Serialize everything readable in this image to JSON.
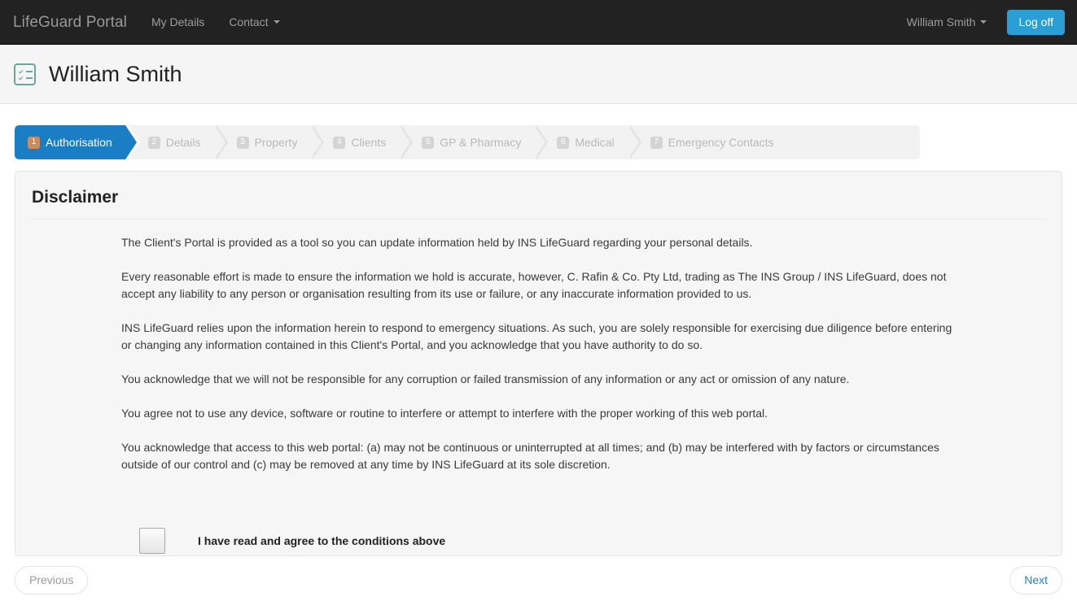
{
  "navbar": {
    "brand": "LifeGuard Portal",
    "links": [
      {
        "label": "My Details",
        "caret": false
      },
      {
        "label": "Contact",
        "caret": true
      }
    ],
    "user_menu": "William Smith",
    "logoff_label": "Log off",
    "background_color": "#222222",
    "accent_color": "#2a9fd6"
  },
  "page_header": {
    "icon": "checklist-icon",
    "title": "William Smith",
    "icon_color": "#6aa99a"
  },
  "wizard": {
    "active_index": 0,
    "active_color": "#1a7ec4",
    "steps": [
      {
        "number": "1",
        "label": "Authorisation"
      },
      {
        "number": "2",
        "label": "Details"
      },
      {
        "number": "3",
        "label": "Property"
      },
      {
        "number": "4",
        "label": "Clients"
      },
      {
        "number": "5",
        "label": "GP & Pharmacy"
      },
      {
        "number": "6",
        "label": "Medical"
      },
      {
        "number": "7",
        "label": "Emergency Contacts"
      }
    ]
  },
  "panel": {
    "title": "Disclaimer",
    "paragraphs": [
      "The Client's Portal is provided as a tool so you can update information held by INS LifeGuard regarding your personal details.",
      "Every reasonable effort is made to ensure the information we hold is accurate, however, C. Rafin & Co. Pty Ltd, trading as The INS Group / INS LifeGuard, does not accept any liability to any person or organisation resulting from its use or failure, or any inaccurate information provided to us.",
      "INS LifeGuard relies upon the information herein to respond to emergency situations. As such, you are solely responsible for exercising due diligence before entering or changing any information contained in this Client's Portal, and you acknowledge that you  have authority to do so.",
      "You acknowledge that we will not be responsible for any corruption or failed transmission of any information or any act or omission of any nature.",
      "You agree  not to use any device, software or routine to interfere or attempt to interfere with the proper working of this web portal.",
      "You acknowledge that access to this web portal: (a) may not be continuous or uninterrupted at all times; and (b) may be interfered with by factors or circumstances outside of our control and (c) may be removed at any time by INS LifeGuard at its sole discretion."
    ],
    "agree_label": "I have read and agree to the conditions above",
    "agree_checked": false
  },
  "footer": {
    "previous_label": "Previous",
    "next_label": "Next"
  }
}
